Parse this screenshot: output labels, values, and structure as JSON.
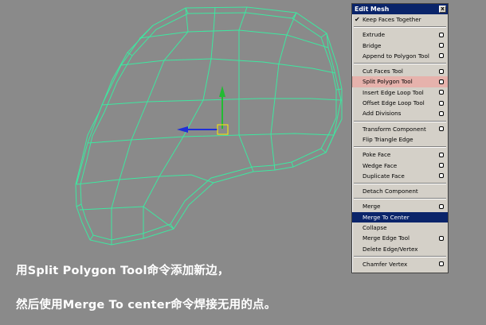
{
  "menu": {
    "title": "Edit Mesh",
    "close_label": "x",
    "groups": [
      [
        {
          "label": "Keep Faces Together",
          "checked": true,
          "option": false
        }
      ],
      [
        {
          "label": "Extrude",
          "option": true
        },
        {
          "label": "Bridge",
          "option": true
        },
        {
          "label": "Append to Polygon Tool",
          "option": true
        }
      ],
      [
        {
          "label": "Cut Faces Tool",
          "option": true
        },
        {
          "label": "Split Polygon Tool",
          "option": true,
          "highlight": "red"
        },
        {
          "label": "Insert Edge Loop Tool",
          "option": true
        },
        {
          "label": "Offset Edge Loop Tool",
          "option": true
        },
        {
          "label": "Add Divisions",
          "option": true
        }
      ],
      [
        {
          "label": "Transform Component",
          "option": true
        },
        {
          "label": "Flip Triangle Edge",
          "option": false
        }
      ],
      [
        {
          "label": "Poke Face",
          "option": true
        },
        {
          "label": "Wedge Face",
          "option": true
        },
        {
          "label": "Duplicate Face",
          "option": true
        }
      ],
      [
        {
          "label": "Detach Component",
          "option": false
        }
      ],
      [
        {
          "label": "Merge",
          "option": true
        },
        {
          "label": "Merge To Center",
          "option": false,
          "highlight": "blue"
        },
        {
          "label": "Collapse",
          "option": false
        },
        {
          "label": "Merge Edge Tool",
          "option": true
        },
        {
          "label": "Delete Edge/Vertex",
          "option": false
        }
      ],
      [
        {
          "label": "Chamfer Vertex",
          "option": true
        }
      ]
    ]
  },
  "caption": {
    "line1": "用Split Polygon Tool命令添加新边，",
    "line2": "然后使用Merge To center命令焊接无用的点。"
  },
  "colors": {
    "wire": "#3de8a0",
    "axis_y": "#22bb33",
    "axis_x": "#1f2fd8",
    "pivot": "#ffee00",
    "menu_highlight_red": "#e6b2ac",
    "menu_highlight_blue": "#0a246a"
  }
}
